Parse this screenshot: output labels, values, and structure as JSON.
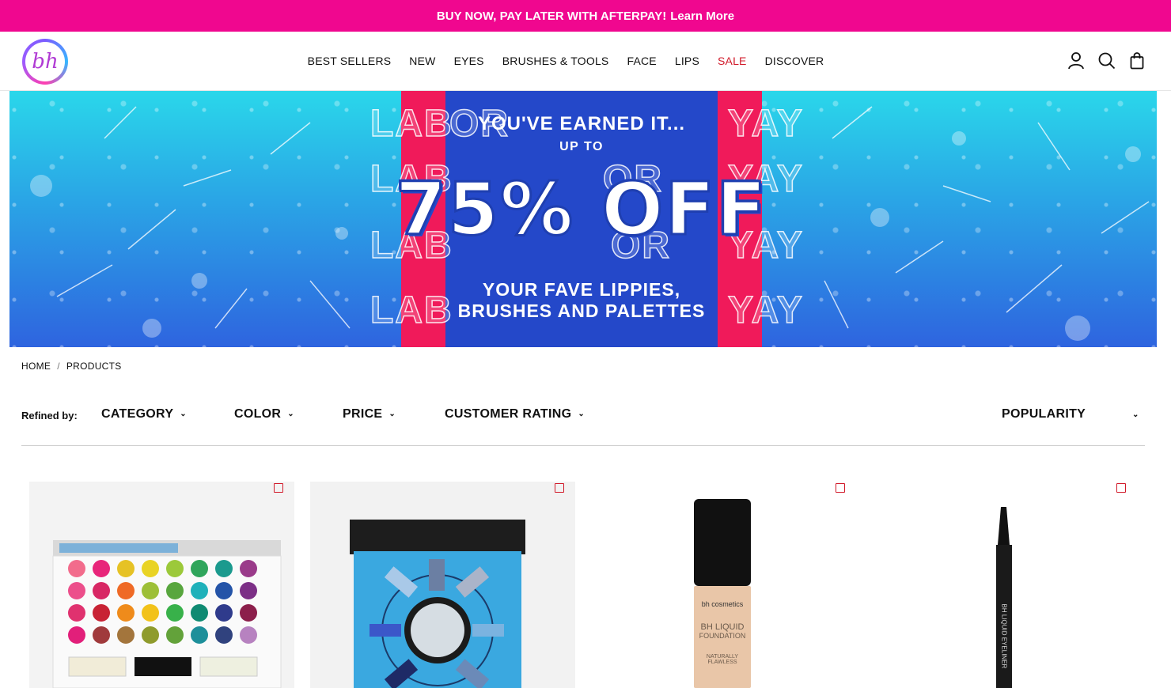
{
  "promo_bar": {
    "text": "BUY NOW, PAY LATER WITH AFTERPAY!",
    "link": "Learn More",
    "color": "#f0078f"
  },
  "logo": {
    "text": "bh"
  },
  "nav": {
    "items": [
      "BEST SELLERS",
      "NEW",
      "EYES",
      "BRUSHES & TOOLS",
      "FACE",
      "LIPS",
      "SALE",
      "DISCOVER"
    ],
    "sale_color": "#d11a2a"
  },
  "header_icons": [
    "account-icon",
    "search-icon",
    "bag-icon"
  ],
  "hero": {
    "line1": "YOU'VE EARNED IT...",
    "line2": "UP TO",
    "line3": "75% OFF",
    "line4a": "YOUR FAVE LIPPIES,",
    "line4b": "BRUSHES AND PALETTES",
    "ghost_words": [
      "LAB",
      "OR",
      "YAY",
      "LAB",
      "OR",
      "YAY",
      "LAB",
      "OR",
      "YAY",
      "LAB",
      "YAY"
    ]
  },
  "breadcrumb": {
    "home": "HOME",
    "sep": "/",
    "current": "PRODUCTS"
  },
  "filters": {
    "label": "Refined by:",
    "category": "CATEGORY",
    "color": "COLOR",
    "price": "PRICE",
    "rating": "CUSTOMER RATING",
    "sort": "POPULARITY"
  },
  "products": [
    {
      "image": "eyeshadow-palette-colorful"
    },
    {
      "image": "eyeshadow-palette-blue-tin"
    },
    {
      "image": "liquid-foundation-bottle",
      "brand": "bh cosmetics",
      "label1": "BH LIQUID",
      "label2": "FOUNDATION",
      "label3": "NATURALLY FLAWLESS"
    },
    {
      "image": "liquid-eyeliner-pen",
      "label1": "BH LIQUID EYELINER"
    }
  ]
}
